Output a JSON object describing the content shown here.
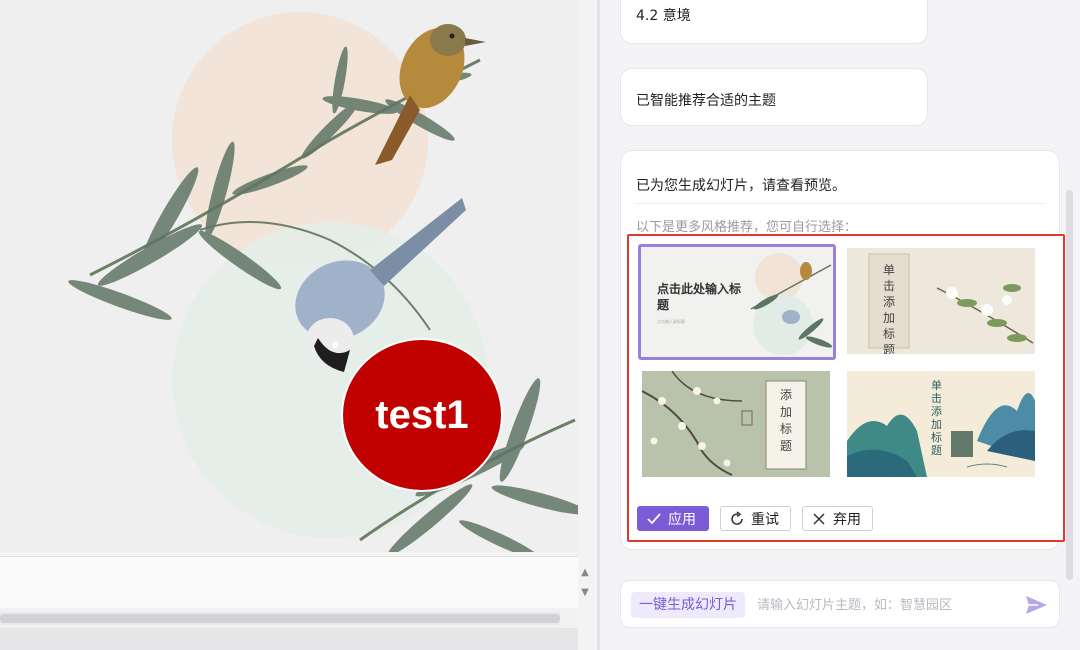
{
  "slide": {
    "shape_text": "test1",
    "shape_color": "#c10000"
  },
  "assistant": {
    "messages": [
      {
        "text": "4.2 意境"
      },
      {
        "text": "已智能推荐合适的主题"
      }
    ],
    "result": {
      "text": "已为您生成幻灯片，请查看预览。",
      "subtext": "以下是更多风格推荐，您可自行选择："
    },
    "themes": [
      {
        "name": "theme-bird-bamboo",
        "title": "点击此处输入标题",
        "subtitle": "点击输入副标题",
        "selected": true
      },
      {
        "name": "theme-white-flowers",
        "title": "单击添加标题",
        "selected": false
      },
      {
        "name": "theme-plum-blossom",
        "title": "添加标题",
        "selected": false
      },
      {
        "name": "theme-blue-landscape",
        "title": "单击添加标题",
        "selected": false
      }
    ],
    "actions": {
      "apply_label": "应用",
      "retry_label": "重试",
      "discard_label": "弃用"
    }
  },
  "input": {
    "quick_tag": "一键生成幻灯片",
    "placeholder": "请输入幻灯片主题，如：智慧园区"
  },
  "colors": {
    "accent": "#7b5bd6",
    "highlight_border": "#e03a2f",
    "shape_red": "#c10000"
  },
  "icons": [
    "check-icon",
    "refresh-icon",
    "close-icon",
    "send-icon",
    "scroll-up-icon",
    "scroll-down-icon"
  ]
}
